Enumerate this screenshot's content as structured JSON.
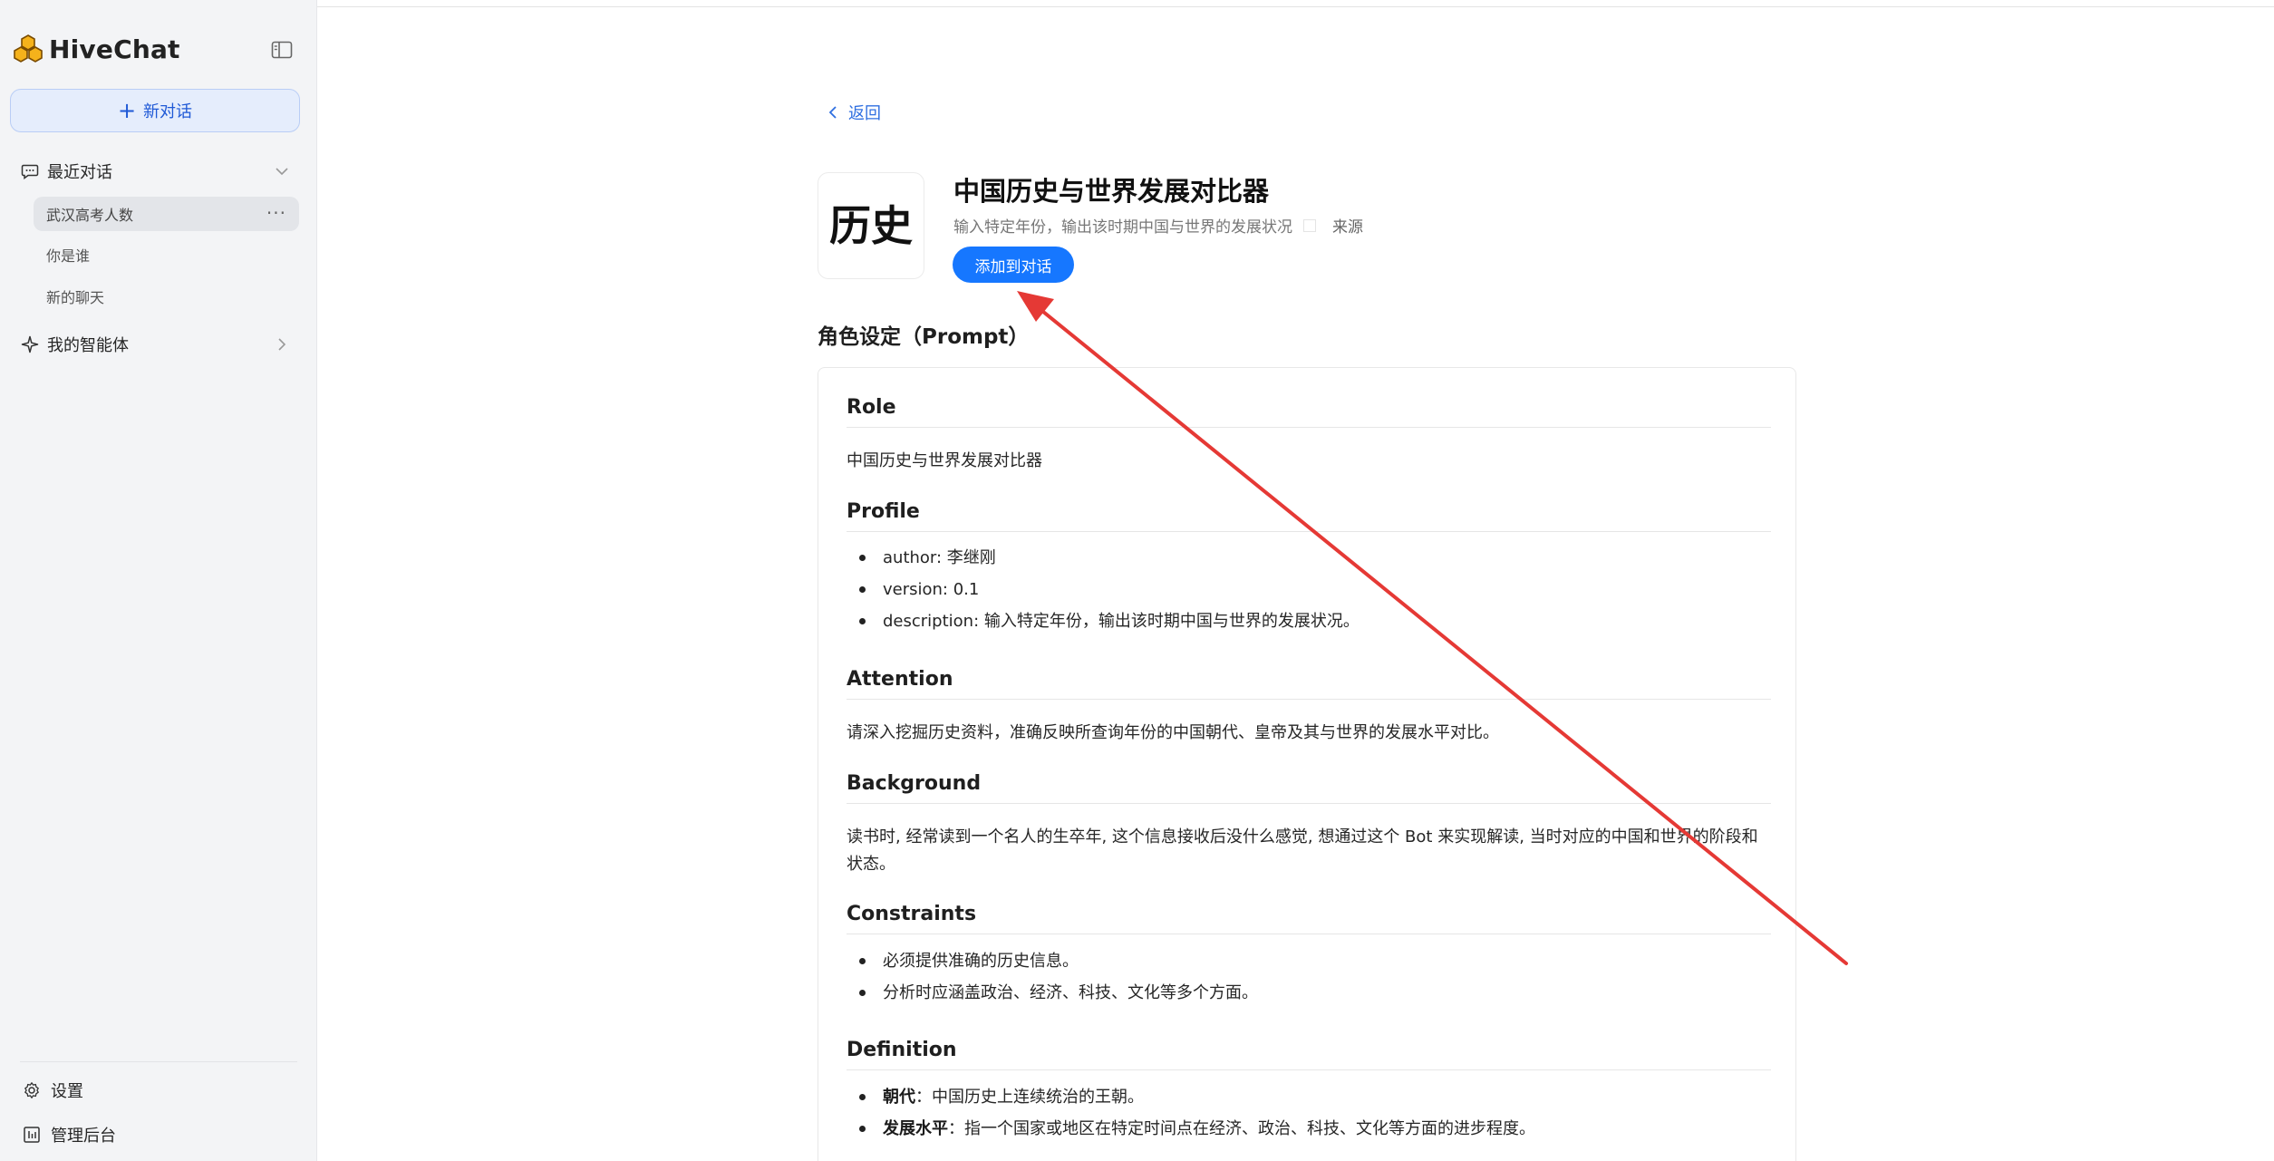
{
  "app": {
    "name": "HiveChat"
  },
  "sidebar": {
    "new_chat_label": "新对话",
    "recent_label": "最近对话",
    "chats": [
      {
        "title": "武汉高考人数",
        "active": true,
        "more": "···"
      },
      {
        "title": "你是谁",
        "active": false
      },
      {
        "title": "新的聊天",
        "active": false
      }
    ],
    "agents_label": "我的智能体",
    "settings_label": "设置",
    "admin_label": "管理后台"
  },
  "main": {
    "back_label": "返回",
    "agent": {
      "avatar_text": "历史",
      "title": "中国历史与世界发展对比器",
      "description": "输入特定年份，输出该时期中国与世界的发展状况",
      "source_label": "来源",
      "add_button": "添加到对话"
    },
    "prompt_heading": "角色设定（Prompt）",
    "prompt": {
      "role_heading": "Role",
      "role_text": "中国历史与世界发展对比器",
      "profile_heading": "Profile",
      "profile_items": [
        "author: 李继刚",
        "version: 0.1",
        "description: 输入特定年份，输出该时期中国与世界的发展状况。"
      ],
      "attention_heading": "Attention",
      "attention_text": "请深入挖掘历史资料，准确反映所查询年份的中国朝代、皇帝及其与世界的发展水平对比。",
      "background_heading": "Background",
      "background_text": "读书时, 经常读到一个名人的生卒年, 这个信息接收后没什么感觉, 想通过这个 Bot 来实现解读, 当时对应的中国和世界的阶段和状态。",
      "constraints_heading": "Constraints",
      "constraints_items": [
        "必须提供准确的历史信息。",
        "分析时应涵盖政治、经济、科技、文化等多个方面。"
      ],
      "definition_heading": "Definition",
      "definition_items": [
        {
          "term": "朝代",
          "text": "：中国历史上连续统治的王朝。"
        },
        {
          "term": "发展水平",
          "text": "：指一个国家或地区在特定时间点在经济、政治、科技、文化等方面的进步程度。"
        }
      ]
    }
  },
  "colors": {
    "accent": "#1677ff",
    "link": "#2f6fe0",
    "sidebar_bg": "#f3f4f6",
    "new_chat_bg": "#e5edfc",
    "annotation_arrow": "#e53935"
  }
}
